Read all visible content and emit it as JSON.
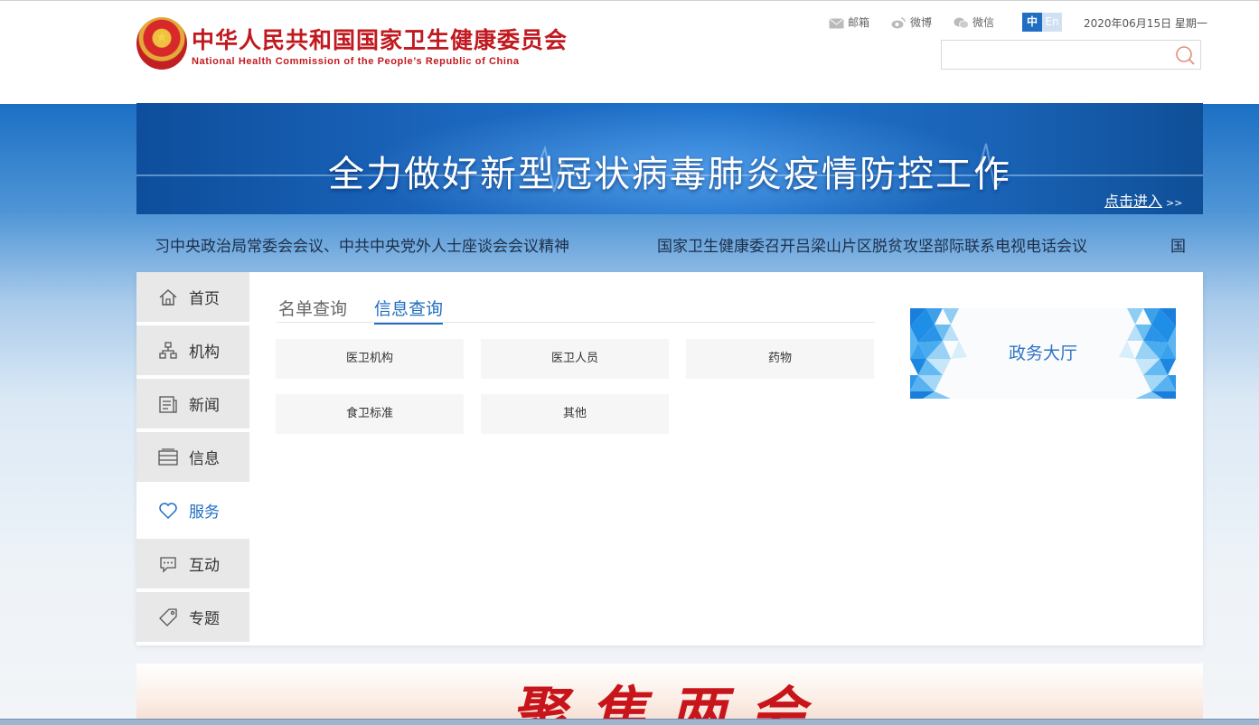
{
  "header": {
    "title_cn": "中华人民共和国国家卫生健康委员会",
    "title_en": "National Health Commission of the People’s Republic of China",
    "links": [
      {
        "label": "邮箱",
        "icon": "mail-icon"
      },
      {
        "label": "微博",
        "icon": "weibo-icon"
      },
      {
        "label": "微信",
        "icon": "wechat-icon"
      }
    ],
    "lang_cn": "中",
    "lang_en": "En",
    "date": "2020年06月15日 星期一",
    "search_placeholder": "",
    "search_value": ""
  },
  "banner": {
    "title": "全力做好新型冠状病毒肺炎疫情防控工作",
    "link": "点击进入",
    "link_arrow": ">>"
  },
  "marquee": [
    "习中央政治局常委会会议、中共中央党外人士座谈会会议精神",
    "国家卫生健康委召开吕梁山片区脱贫攻坚部际联系电视电话会议",
    "国"
  ],
  "nav": [
    {
      "label": "首页",
      "icon": "home-icon"
    },
    {
      "label": "机构",
      "icon": "org-chart-icon"
    },
    {
      "label": "新闻",
      "icon": "news-icon"
    },
    {
      "label": "信息",
      "icon": "info-stack-icon"
    },
    {
      "label": "服务",
      "icon": "heart-icon",
      "active": true
    },
    {
      "label": "互动",
      "icon": "chat-icon"
    },
    {
      "label": "专题",
      "icon": "tag-icon"
    }
  ],
  "tabs": [
    {
      "label": "名单查询"
    },
    {
      "label": "信息查询",
      "active": true
    }
  ],
  "services": [
    "医卫机构",
    "医卫人员",
    "药物",
    "食卫标准",
    "其他"
  ],
  "hall": {
    "label": "政务大厅"
  },
  "promo": {
    "text": "聚焦两会"
  },
  "colors": {
    "accent": "#1f6ec2",
    "brand_red": "#c1191f",
    "banner_blue": "#1b66bd"
  }
}
